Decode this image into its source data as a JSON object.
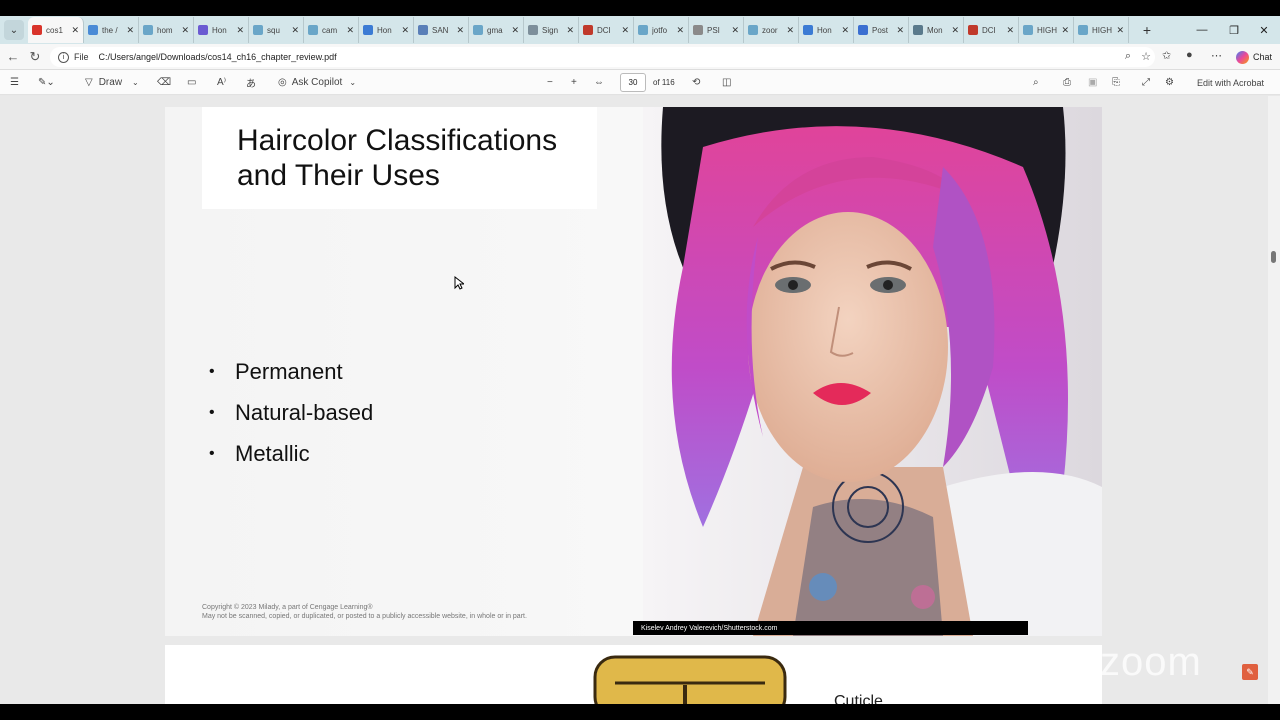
{
  "browser": {
    "tabs": [
      {
        "label": "cos1",
        "color": "#d9342b",
        "active": true
      },
      {
        "label": "the /",
        "color": "#4a8bd6"
      },
      {
        "label": "hom",
        "color": "#6aa6c8"
      },
      {
        "label": "Hon",
        "color": "#6b5bd2"
      },
      {
        "label": "squ",
        "color": "#6aa6c8"
      },
      {
        "label": "cam",
        "color": "#6aa6c8"
      },
      {
        "label": "Hon",
        "color": "#3b7bd4"
      },
      {
        "label": "SAN",
        "color": "#5a7fb8"
      },
      {
        "label": "gma",
        "color": "#6aa6c8"
      },
      {
        "label": "Sign",
        "color": "#7d8f9b"
      },
      {
        "label": "DCI",
        "color": "#c0392b"
      },
      {
        "label": "jotfo",
        "color": "#6aa6c8"
      },
      {
        "label": "PSI",
        "color": "#8a8a8a"
      },
      {
        "label": "zoor",
        "color": "#6aa6c8"
      },
      {
        "label": "Hon",
        "color": "#3b7bd4"
      },
      {
        "label": "Post",
        "color": "#3b6fd1"
      },
      {
        "label": "Mon",
        "color": "#5a7a8c"
      },
      {
        "label": "DCI",
        "color": "#c0392b"
      },
      {
        "label": "HIGH",
        "color": "#6aa6c8"
      },
      {
        "label": "HIGH",
        "color": "#6aa6c8"
      }
    ],
    "address": {
      "scheme_label": "File",
      "url": "C:/Users/angel/Downloads/cos14_ch16_chapter_review.pdf"
    },
    "chat_label": "Chat"
  },
  "pdf_toolbar": {
    "draw_label": "Draw",
    "copilot_label": "Ask Copilot",
    "page_number": "30",
    "page_total": "of 116",
    "edit_label": "Edit with Acrobat"
  },
  "slide": {
    "title": "Haircolor Classifications\nand Their Uses",
    "bullets": [
      "Permanent",
      "Natural-based",
      "Metallic"
    ],
    "copyright_line1": "Copyright © 2023 Milady, a part of Cengage Learning®",
    "copyright_line2": "May not be scanned, copied, or duplicated, or posted to a publicly accessible website, in whole or in part.",
    "photo_credit": "Kiselev Andrey Valerevich/Shutterstock.com"
  },
  "next_slide": {
    "partial_label": "Cuticle"
  },
  "watermark": "zoom"
}
